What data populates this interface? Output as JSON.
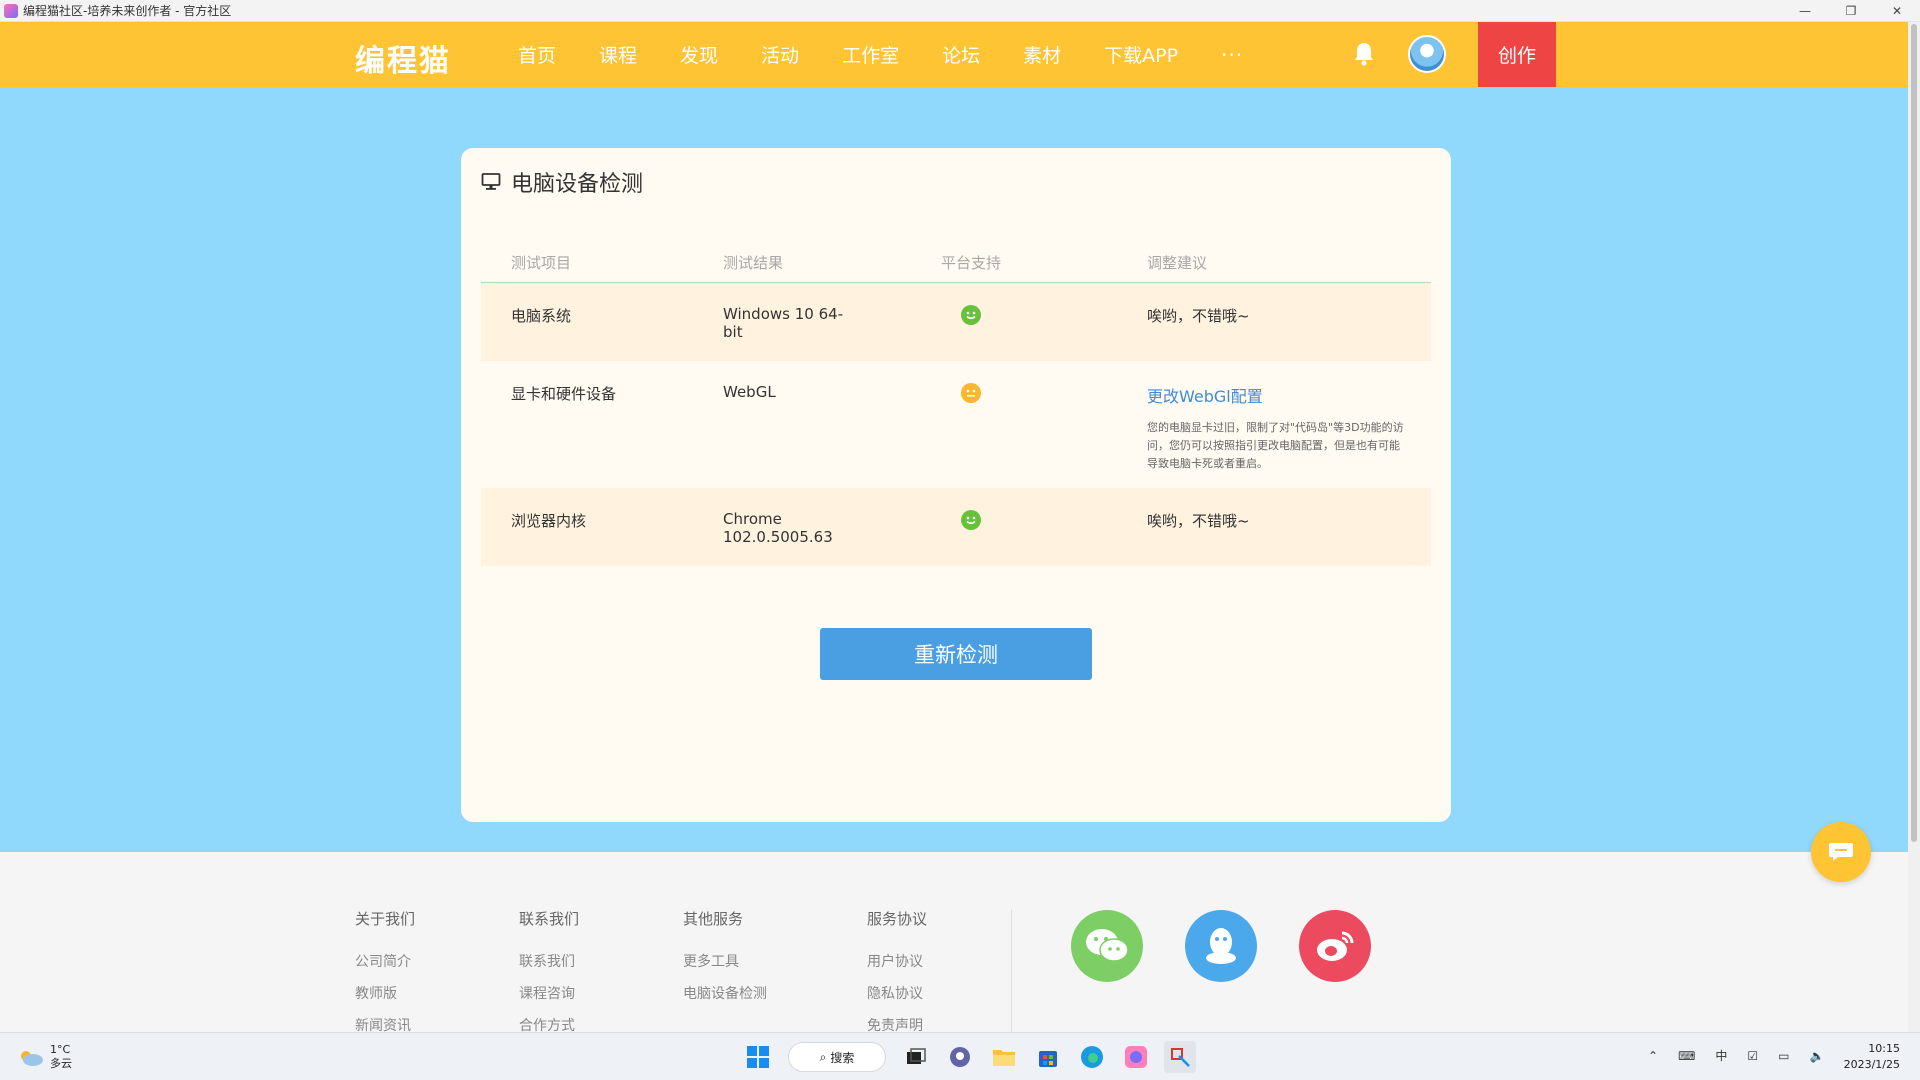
{
  "window": {
    "title": "编程猫社区-培养未来创作者 - 官方社区",
    "controls": [
      "—",
      "❐",
      "✕"
    ]
  },
  "nav": {
    "logo": "编程猫",
    "items": [
      "首页",
      "课程",
      "发现",
      "活动",
      "工作室",
      "论坛",
      "素材",
      "下载APP"
    ],
    "more": "···",
    "create": "创作"
  },
  "check": {
    "title": "电脑设备检测",
    "headers": [
      "测试项目",
      "测试结果",
      "平台支持",
      "调整建议"
    ],
    "rows": [
      {
        "item": "电脑系统",
        "result": "Windows 10 64-bit",
        "status": "good",
        "advice": "唉哟，不错哦~"
      },
      {
        "item": "显卡和硬件设备",
        "result": "WebGL",
        "status": "warn",
        "advice": "更改WebGl配置",
        "note": "您的电脑显卡过旧，限制了对\"代码岛\"等3D功能的访问，您仍可以按照指引更改电脑配置，但是也有可能导致电脑卡死或者重启。"
      },
      {
        "item": "浏览器内核",
        "result": "Chrome 102.0.5005.63",
        "status": "good",
        "advice": "唉哟，不错哦~"
      }
    ],
    "recheck": "重新检测",
    "colors": {
      "good": "#67c23a",
      "warn": "#f7b731",
      "link": "#3f8bd9"
    }
  },
  "footer": {
    "columns": [
      {
        "title": "关于我们",
        "items": [
          "公司简介",
          "教师版",
          "新闻资讯"
        ]
      },
      {
        "title": "联系我们",
        "items": [
          "联系我们",
          "课程咨询",
          "合作方式"
        ]
      },
      {
        "title": "其他服务",
        "items": [
          "更多工具",
          "电脑设备检测"
        ]
      },
      {
        "title": "服务协议",
        "items": [
          "用户协议",
          "隐私协议",
          "免责声明"
        ]
      }
    ],
    "social": [
      "wechat-icon",
      "qq-icon",
      "weibo-icon"
    ]
  },
  "taskbar": {
    "weather_temp": "1°C",
    "weather_desc": "多云",
    "search": "搜索",
    "time": "10:15",
    "date": "2023/1/25",
    "ime": "中"
  }
}
